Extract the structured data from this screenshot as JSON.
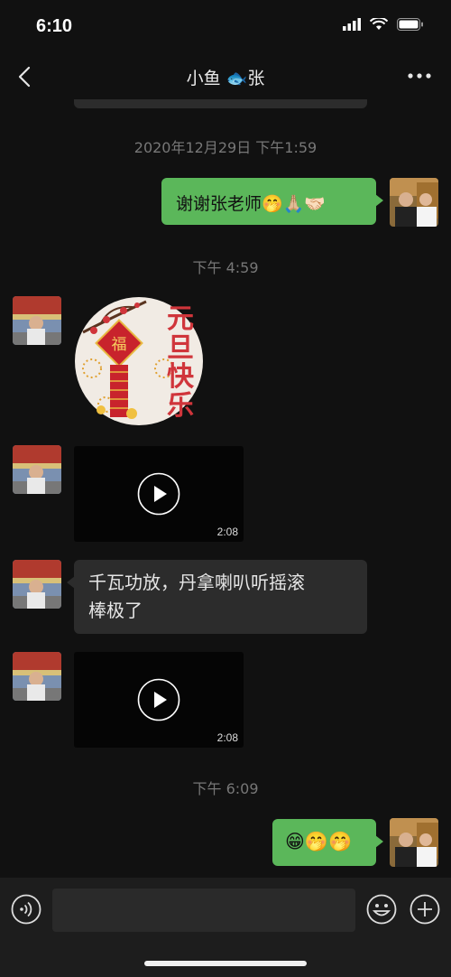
{
  "status_bar": {
    "time": "6:10"
  },
  "header": {
    "title": "小鱼 🐟张"
  },
  "messages": [
    {
      "type": "timestamp",
      "text": "2020年12月29日 下午1:59"
    },
    {
      "type": "outgoing_text",
      "text": "谢谢张老师🤭🙏🏼🤝🏻"
    },
    {
      "type": "timestamp",
      "text": "下午 4:59"
    },
    {
      "type": "incoming_sticker",
      "text": "元旦快乐",
      "sub": "福"
    },
    {
      "type": "incoming_video",
      "duration": "2:08"
    },
    {
      "type": "incoming_text",
      "text_line1": "千瓦功放，丹拿喇叭听摇滚",
      "text_line2": "棒极了"
    },
    {
      "type": "incoming_video",
      "duration": "2:08"
    },
    {
      "type": "timestamp",
      "text": "下午 6:09"
    },
    {
      "type": "outgoing_text",
      "text": "😁🤭🤭"
    }
  ],
  "colors": {
    "background": "#111111",
    "outgoing_bubble": "#5bb75a",
    "incoming_bubble": "#2c2c2c",
    "timestamp": "#777777"
  }
}
